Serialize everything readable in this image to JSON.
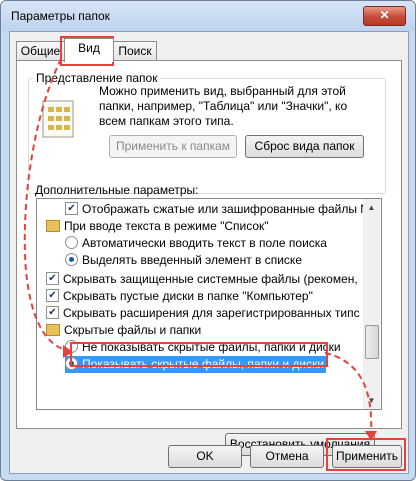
{
  "window": {
    "title": "Параметры папок",
    "close_label": "✕"
  },
  "tabs": [
    "Общие",
    "Вид",
    "Поиск"
  ],
  "folder_view": {
    "label": "Представление папок",
    "description": "Можно применить вид, выбранный для этой папки, например, \"Таблица\" или \"Значки\", ко всем папкам этого типа.",
    "apply_button": "Применить к папкам",
    "reset_button": "Сброс вида папок"
  },
  "advanced": {
    "label": "Дополнительные параметры:",
    "items": [
      {
        "text": "Отображать сжатые или зашифрованные файлы NTI",
        "kind": "checkbox",
        "checked": true
      },
      {
        "text": "При вводе текста в режиме \"Список\"",
        "kind": "folder"
      },
      {
        "text": "Автоматически вводить текст в поле поиска",
        "kind": "radio",
        "checked": false
      },
      {
        "text": "Выделять введенный элемент в списке",
        "kind": "radio",
        "checked": true
      },
      {
        "text": "Скрывать защищенные системные файлы (рекомен,",
        "kind": "checkbox",
        "checked": true
      },
      {
        "text": "Скрывать пустые диски в папке \"Компьютер\"",
        "kind": "checkbox",
        "checked": true
      },
      {
        "text": "Скрывать расширения для зарегистрированных типс",
        "kind": "checkbox",
        "checked": true
      },
      {
        "text": "Скрытые файлы и папки",
        "kind": "folder"
      },
      {
        "text": "Не показывать скрытые файлы, папки и диски",
        "kind": "radio",
        "checked": false
      },
      {
        "text": "Показывать скрытые файлы, папки и диски",
        "kind": "radio",
        "checked": true
      }
    ]
  },
  "restore_button": "Восстановить умолчания",
  "footer": {
    "ok": "OK",
    "cancel": "Отмена",
    "apply": "Применить"
  },
  "annotation_color": "#e8413c"
}
